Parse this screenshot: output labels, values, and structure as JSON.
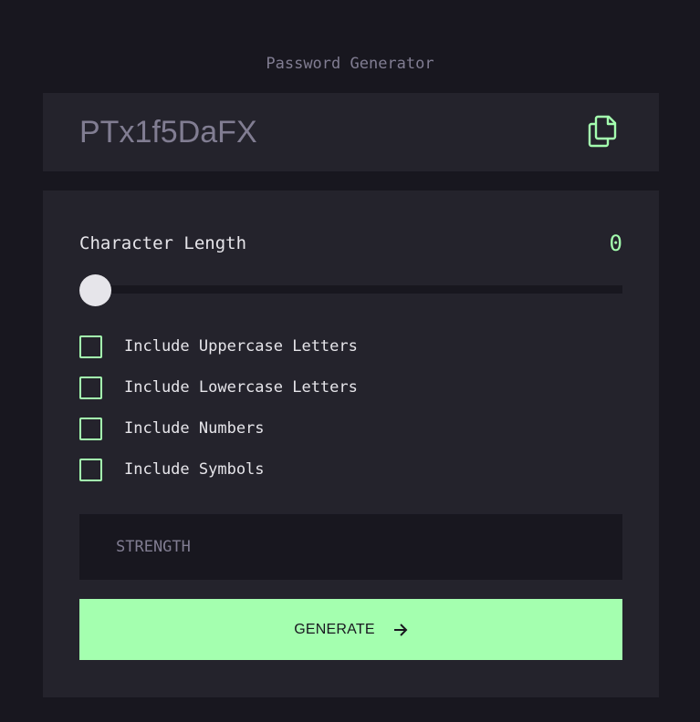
{
  "app": {
    "title": "Password Generator"
  },
  "password": {
    "value": "PTx1f5DaFX",
    "copy_icon": "copy-icon"
  },
  "length": {
    "label": "Character Length",
    "value": "0",
    "slider_fraction": 0
  },
  "options": [
    {
      "label": "Include Uppercase Letters",
      "checked": false
    },
    {
      "label": "Include Lowercase Letters",
      "checked": false
    },
    {
      "label": "Include Numbers",
      "checked": false
    },
    {
      "label": "Include Symbols",
      "checked": false
    }
  ],
  "strength": {
    "label": "STRENGTH"
  },
  "generate": {
    "label": "GENERATE",
    "icon": "arrow-right-icon"
  },
  "colors": {
    "background": "#18171f",
    "panel": "#24232c",
    "accent": "#a4ffaf",
    "muted": "#817d92",
    "text": "#e6e5ea"
  }
}
